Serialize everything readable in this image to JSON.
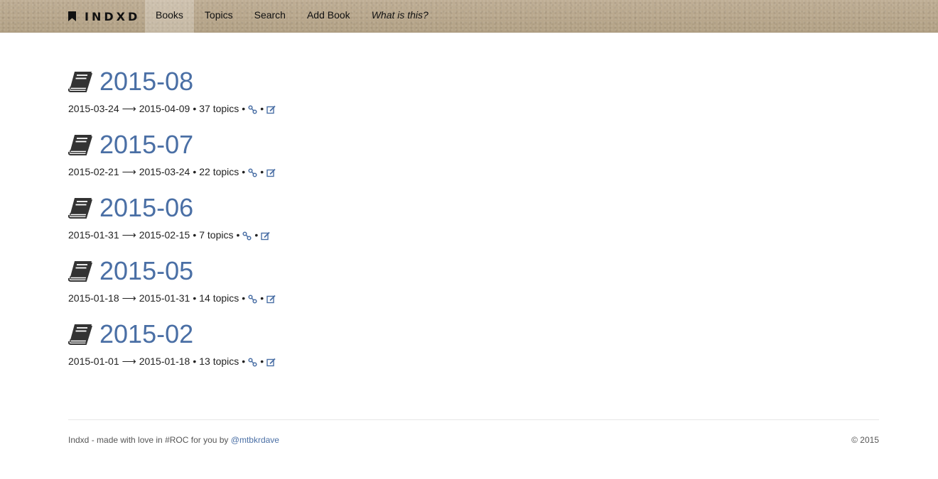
{
  "navbar": {
    "brand": "INDXD",
    "items": [
      {
        "label": "Books",
        "active": true
      },
      {
        "label": "Topics"
      },
      {
        "label": "Search"
      },
      {
        "label": "Add Book"
      },
      {
        "label": "What is this?",
        "italic": true
      }
    ]
  },
  "books": [
    {
      "title": "2015-08",
      "start": "2015-03-24",
      "end": "2015-04-09",
      "topics": "37 topics"
    },
    {
      "title": "2015-07",
      "start": "2015-02-21",
      "end": "2015-03-24",
      "topics": "22 topics"
    },
    {
      "title": "2015-06",
      "start": "2015-01-31",
      "end": "2015-02-15",
      "topics": "7 topics"
    },
    {
      "title": "2015-05",
      "start": "2015-01-18",
      "end": "2015-01-31",
      "topics": "14 topics"
    },
    {
      "title": "2015-02",
      "start": "2015-01-01",
      "end": "2015-01-18",
      "topics": "13 topics"
    }
  ],
  "meta": {
    "arrow": "⟶",
    "bullet": "•",
    "link_icon": "link-icon",
    "edit_icon": "edit-icon",
    "book_icon": "book-icon"
  },
  "footer": {
    "text": "Indxd - made with love in #ROC for you by ",
    "author": "@mtbkrdave",
    "copyright": "© 2015"
  },
  "colors": {
    "link": "#4a6fa5",
    "navbar": "#b9a88f"
  }
}
